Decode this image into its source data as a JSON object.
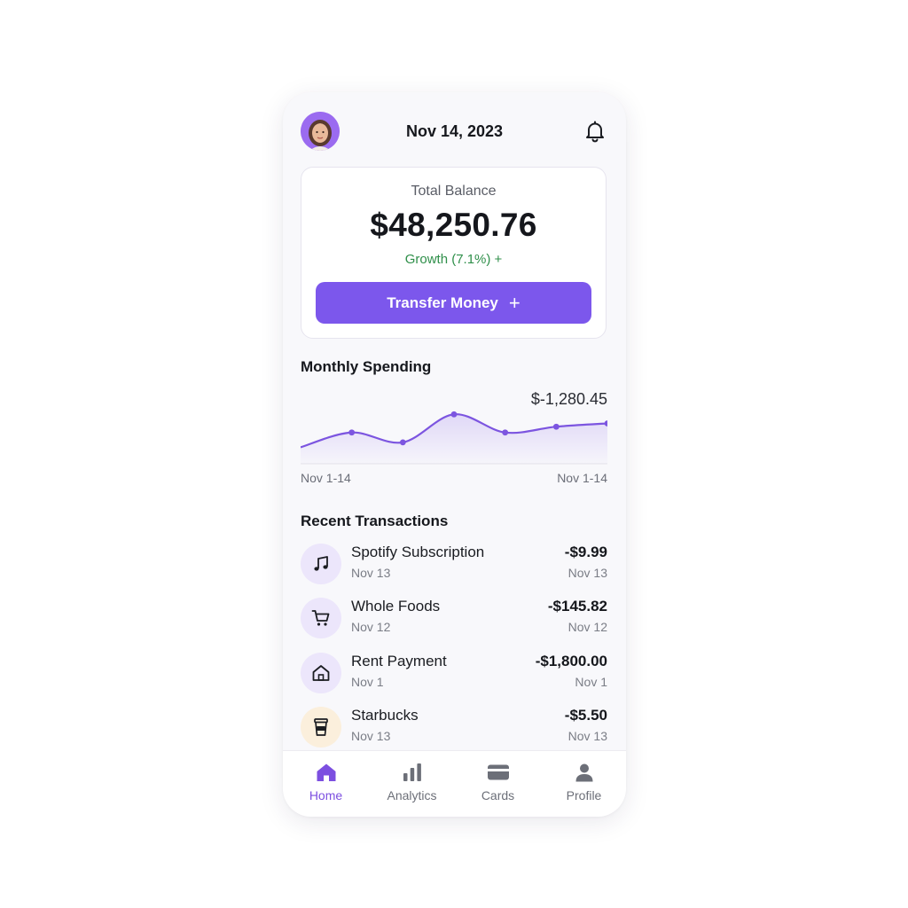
{
  "header": {
    "date": "Nov 14, 2023",
    "avatar_icon": "user-avatar",
    "notification_icon": "bell-icon"
  },
  "balance": {
    "label": "Total Balance",
    "amount": "$48,250.76",
    "growth": "Growth (7.1%) +",
    "transfer_label": "Transfer Money",
    "transfer_icon_glyph": "+"
  },
  "spending": {
    "title": "Monthly Spending",
    "value": "$-1,280.45",
    "start_label": "Nov 1-14",
    "end_label": "Nov 1-14",
    "chart_data": {
      "type": "area",
      "x": [
        1,
        2,
        3,
        4,
        5,
        6,
        7
      ],
      "series": [
        {
          "values": [
            20,
            38,
            26,
            60,
            38,
            45,
            49
          ]
        }
      ],
      "ylim": [
        0,
        70
      ],
      "grid": false,
      "line_color": "#7c55e0"
    }
  },
  "transactions": {
    "title": "Recent Transactions",
    "items": [
      {
        "name": "Spotify Subscription",
        "date": "Nov 13",
        "amount": "-$9.99",
        "date_right": "Nov 13",
        "icon": "music-note-icon",
        "icon_bg": "#ece6fb"
      },
      {
        "name": "Whole Foods",
        "date": "Nov 12",
        "amount": "-$145.82",
        "date_right": "Nov 12",
        "icon": "shopping-cart-icon",
        "icon_bg": "#ece6fb"
      },
      {
        "name": "Rent Payment",
        "date": "Nov 1",
        "amount": "-$1,800.00",
        "date_right": "Nov 1",
        "icon": "house-icon",
        "icon_bg": "#ece6fb"
      },
      {
        "name": "Starbucks",
        "date": "Nov 13",
        "amount": "-$5.50",
        "date_right": "Nov 13",
        "icon": "coffee-cup-icon",
        "icon_bg": "#fbefdc"
      }
    ]
  },
  "nav": {
    "items": [
      {
        "label": "Home",
        "icon": "home-icon",
        "active": true
      },
      {
        "label": "Analytics",
        "icon": "bar-chart-icon",
        "active": false
      },
      {
        "label": "Cards",
        "icon": "card-icon",
        "active": false
      },
      {
        "label": "Profile",
        "icon": "person-icon",
        "active": false
      }
    ]
  },
  "colors": {
    "accent": "#7c57ec",
    "positive": "#2f8f4a",
    "active_nav": "#7c4fe0"
  }
}
